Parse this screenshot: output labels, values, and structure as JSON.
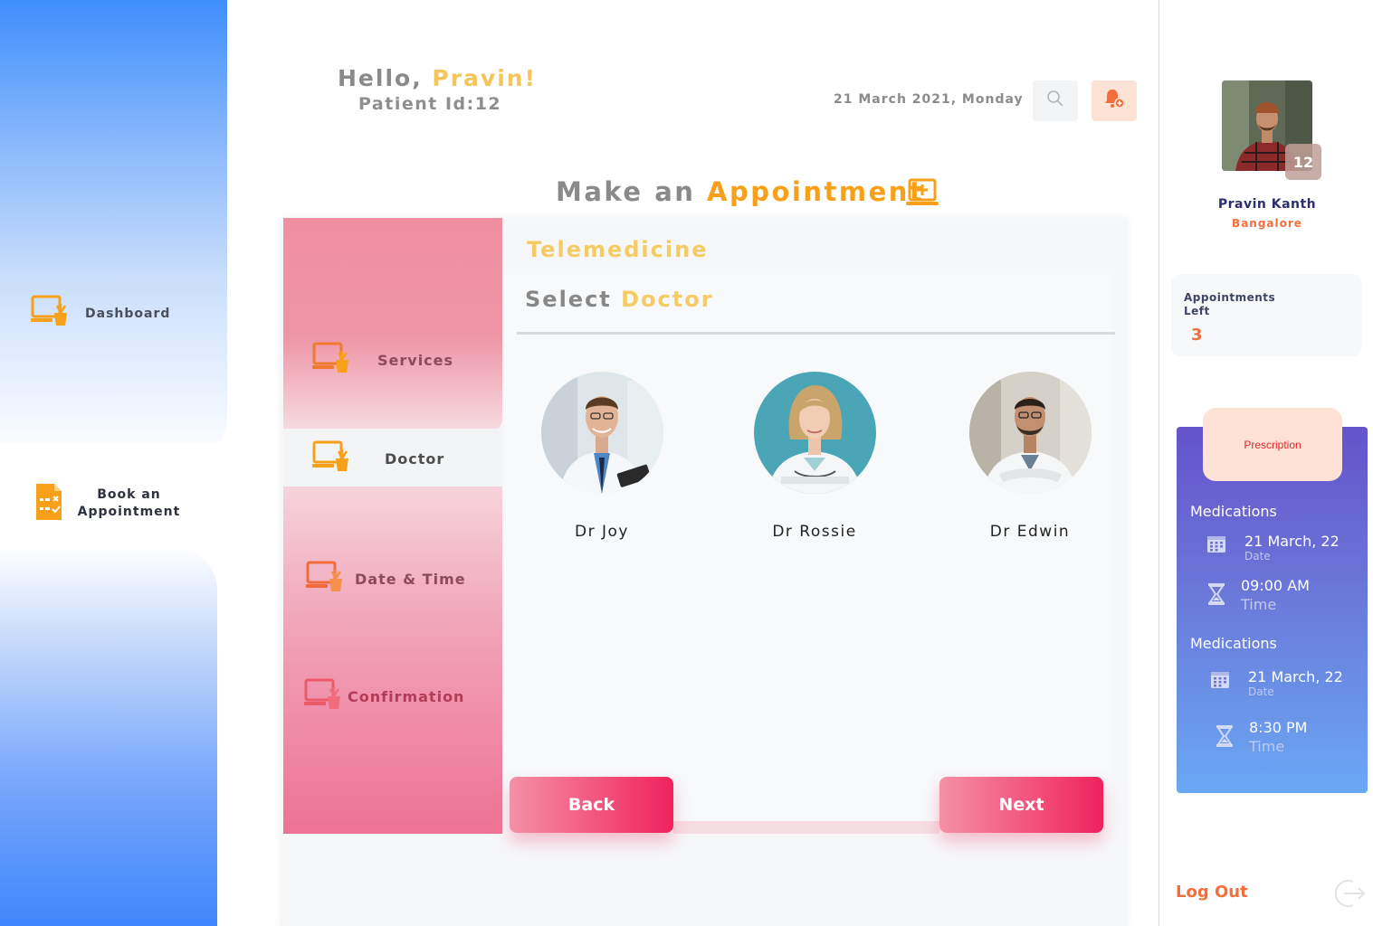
{
  "header": {
    "greeting": "Hello, ",
    "user_name": "Pravin!",
    "patient_id": "Patient Id:12",
    "date": "21 March 2021, Monday"
  },
  "sidebar": {
    "items": [
      {
        "label": "Dashboard",
        "icon": "laptop-plant-icon"
      },
      {
        "label_line1": "Book an",
        "label_line2": "Appointment",
        "icon": "document-checklist-icon"
      }
    ]
  },
  "page": {
    "title_prefix": "Make an",
    "title_accent": "Appointment"
  },
  "steps": [
    {
      "label": "Services"
    },
    {
      "label": "Doctor"
    },
    {
      "label": "Date & Time"
    },
    {
      "label": "Confirmation"
    }
  ],
  "content": {
    "service": "Telemedicine",
    "select_prefix": "Select",
    "select_accent": "Doctor",
    "doctors": [
      {
        "name": "Dr Joy"
      },
      {
        "name": "Dr Rossie"
      },
      {
        "name": "Dr Edwin"
      }
    ],
    "back_label": "Back",
    "next_label": "Next"
  },
  "profile": {
    "badge": "12",
    "name": "Pravin Kanth",
    "city": "Bangalore",
    "appointments_label": "Appointments Left",
    "appointments_left": "3"
  },
  "prescription": {
    "tab_label": "Prescription",
    "entries": [
      {
        "heading": "Medications",
        "date": "21 March, 22",
        "date_label": "Date",
        "time": "09:00 AM",
        "time_label": "Time"
      },
      {
        "heading": "Medications",
        "date": "21 March, 22",
        "date_label": "Date",
        "time": "8:30 PM",
        "time_label": "Time"
      }
    ]
  },
  "logout_label": "Log Out",
  "colors": {
    "accent_orange": "#f8a01a",
    "accent_yellow": "#f6cb63",
    "logout_orange": "#f36e3a",
    "button_pink": "#f0225d",
    "sidebar_blue": "#3f8efc"
  }
}
